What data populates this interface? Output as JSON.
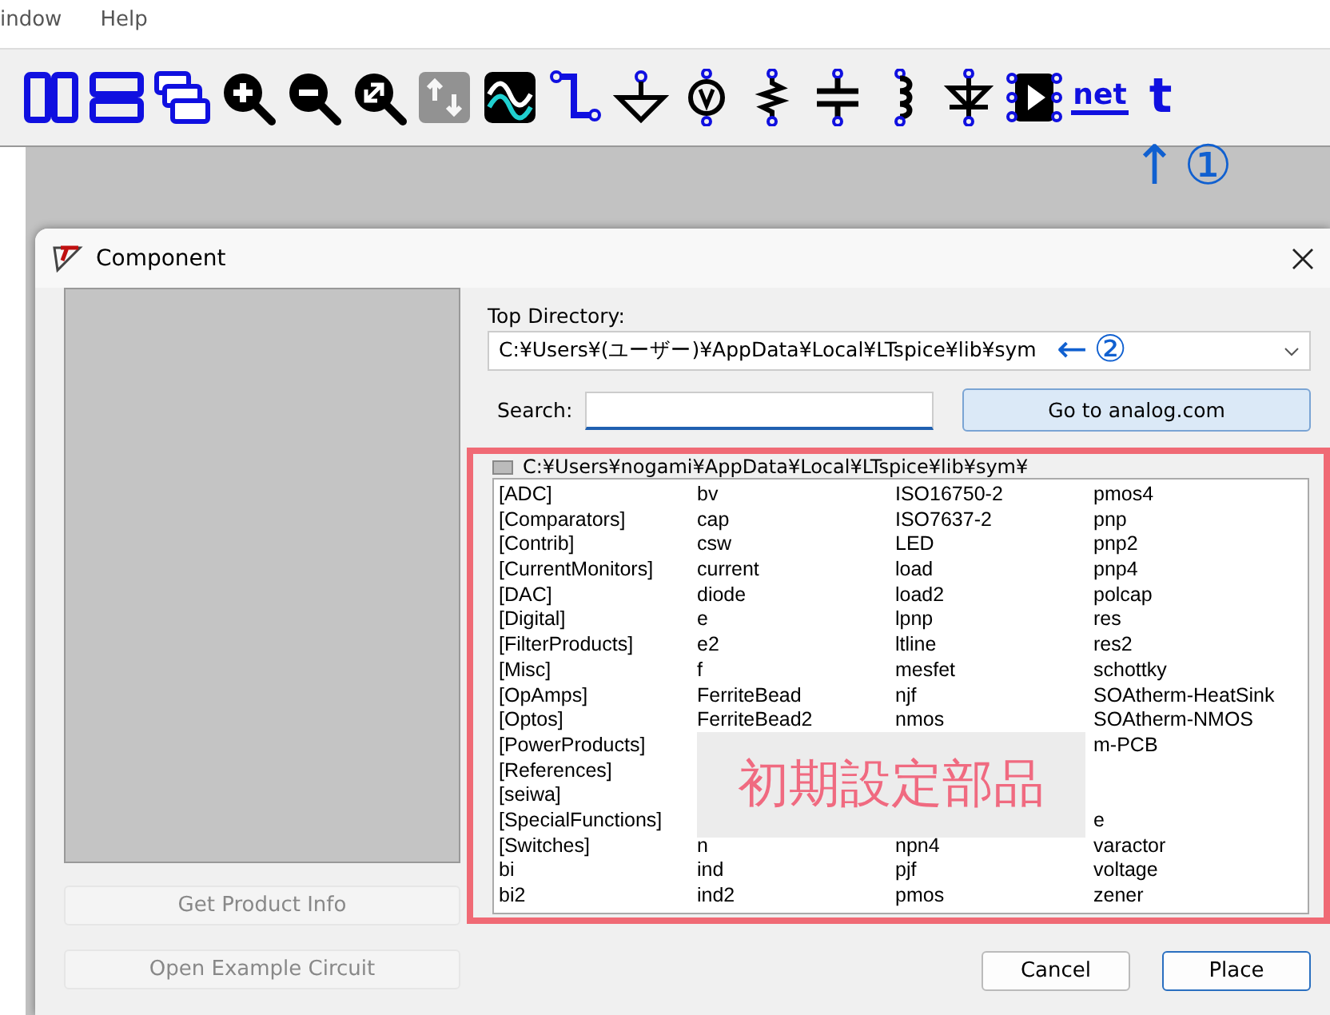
{
  "menu": [
    {
      "label": "indow"
    },
    {
      "label": "Help"
    }
  ],
  "toolbar": [
    {
      "kind": "tile-v",
      "disabled": false
    },
    {
      "kind": "tile-h",
      "disabled": false
    },
    {
      "kind": "cascade",
      "disabled": false
    },
    {
      "kind": "zoom-in",
      "disabled": false
    },
    {
      "kind": "zoom-out",
      "disabled": false
    },
    {
      "kind": "zoom-fit",
      "disabled": false
    },
    {
      "kind": "pan",
      "disabled": true
    },
    {
      "kind": "waveform",
      "disabled": false
    },
    {
      "kind": "wire",
      "disabled": false
    },
    {
      "kind": "ground",
      "disabled": false
    },
    {
      "kind": "voltage",
      "disabled": false
    },
    {
      "kind": "resistor",
      "disabled": false
    },
    {
      "kind": "capacitor",
      "disabled": false
    },
    {
      "kind": "inductor",
      "disabled": false
    },
    {
      "kind": "diode",
      "disabled": false
    },
    {
      "kind": "component",
      "disabled": false
    },
    {
      "kind": "net",
      "label": "net",
      "disabled": false
    },
    {
      "kind": "text",
      "label": "t",
      "disabled": false
    }
  ],
  "annotation_1": {
    "arrow": "↑",
    "mark": "①"
  },
  "dialog": {
    "title": "Component",
    "left_buttons": [
      {
        "label": "Get Product Info",
        "disabled": true
      },
      {
        "label": "Open Example Circuit",
        "disabled": true
      }
    ],
    "top_directory_label": "Top Directory:",
    "top_directory": "C:¥Users¥(ユーザー)¥AppData¥Local¥LTspice¥lib¥sym",
    "annotation_2": {
      "arrow": "←",
      "mark": "②"
    },
    "search_label": "Search:",
    "web_button": "Go to analog.com",
    "path": "C:¥Users¥nogami¥AppData¥Local¥LTspice¥lib¥sym¥",
    "columns": [
      [
        "[ADC]",
        "[Comparators]",
        "[Contrib]",
        "[CurrentMonitors]",
        "[DAC]",
        "[Digital]",
        "[FilterProducts]",
        "[Misc]",
        "[OpAmps]",
        "[Optos]",
        "[PowerProducts]",
        "[References]",
        "[seiwa]",
        "[SpecialFunctions]",
        "[Switches]",
        "bi",
        "bi2"
      ],
      [
        "bv",
        "cap",
        "csw",
        "current",
        "diode",
        "e",
        "e2",
        "f",
        "FerriteBead",
        "FerriteBead2",
        null,
        null,
        null,
        null,
        "n",
        "ind",
        "ind2"
      ],
      [
        "ISO16750-2",
        "ISO7637-2",
        "LED",
        "load",
        "load2",
        "lpnp",
        "ltline",
        "mesfet",
        "njf",
        "nmos",
        null,
        null,
        null,
        null,
        "npn4",
        "pjf",
        "pmos"
      ],
      [
        "pmos4",
        "pnp",
        "pnp2",
        "pnp4",
        "polcap",
        "res",
        "res2",
        "schottky",
        "SOAtherm-HeatSink",
        "SOAtherm-NMOS",
        "m-PCB",
        null,
        null,
        "e",
        "varactor",
        "voltage",
        "zener"
      ]
    ],
    "overlay_label": "初期設定部品",
    "buttons": [
      {
        "label": "Cancel",
        "default": false
      },
      {
        "label": "Place",
        "default": true
      }
    ]
  }
}
